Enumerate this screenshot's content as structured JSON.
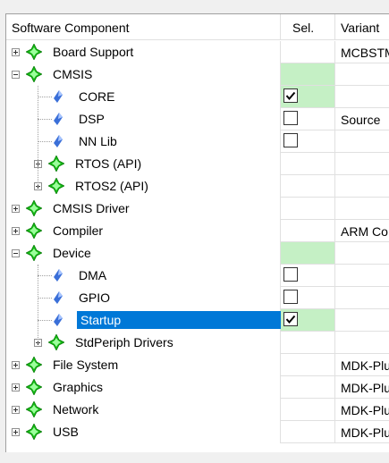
{
  "columns": {
    "component": "Software Component",
    "sel": "Sel.",
    "variant": "Variant"
  },
  "colors": {
    "selected_bg": "#0078d7",
    "sel_green": "#c5f0c5",
    "gem_green": "#14b814",
    "diamond_blue": "#3a6fd8"
  },
  "rows": [
    {
      "label": "Board Support",
      "level": 0,
      "kind": "group",
      "expander": "plus",
      "sel": "",
      "variant": "MCBSTM"
    },
    {
      "label": "CMSIS",
      "level": 0,
      "kind": "group",
      "expander": "minus",
      "sel": "green",
      "variant": ""
    },
    {
      "label": "CORE",
      "level": 1,
      "kind": "item",
      "sel": "checked",
      "variant": ""
    },
    {
      "label": "DSP",
      "level": 1,
      "kind": "item",
      "sel": "unchecked",
      "variant": "Source"
    },
    {
      "label": "NN Lib",
      "level": 1,
      "kind": "item",
      "sel": "unchecked",
      "variant": ""
    },
    {
      "label": "RTOS (API)",
      "level": 1,
      "kind": "group",
      "expander": "plus",
      "sel": "",
      "variant": ""
    },
    {
      "label": "RTOS2 (API)",
      "level": 1,
      "kind": "group",
      "expander": "plus",
      "sel": "",
      "variant": ""
    },
    {
      "label": "CMSIS Driver",
      "level": 0,
      "kind": "group",
      "expander": "plus",
      "sel": "",
      "variant": ""
    },
    {
      "label": "Compiler",
      "level": 0,
      "kind": "group",
      "expander": "plus",
      "sel": "",
      "variant": "ARM Co"
    },
    {
      "label": "Device",
      "level": 0,
      "kind": "group",
      "expander": "minus",
      "sel": "green",
      "variant": ""
    },
    {
      "label": "DMA",
      "level": 1,
      "kind": "item",
      "sel": "unchecked",
      "variant": ""
    },
    {
      "label": "GPIO",
      "level": 1,
      "kind": "item",
      "sel": "unchecked",
      "variant": ""
    },
    {
      "label": "Startup",
      "level": 1,
      "kind": "item",
      "sel": "checked-green",
      "variant": "",
      "selected": true
    },
    {
      "label": "StdPeriph Drivers",
      "level": 1,
      "kind": "group",
      "expander": "plus",
      "sel": "",
      "variant": ""
    },
    {
      "label": "File System",
      "level": 0,
      "kind": "group",
      "expander": "plus",
      "sel": "",
      "variant": "MDK-Plu"
    },
    {
      "label": "Graphics",
      "level": 0,
      "kind": "group",
      "expander": "plus",
      "sel": "",
      "variant": "MDK-Plu"
    },
    {
      "label": "Network",
      "level": 0,
      "kind": "group",
      "expander": "plus",
      "sel": "",
      "variant": "MDK-Plu"
    },
    {
      "label": "USB",
      "level": 0,
      "kind": "group",
      "expander": "plus",
      "sel": "",
      "variant": "MDK-Plu"
    }
  ]
}
